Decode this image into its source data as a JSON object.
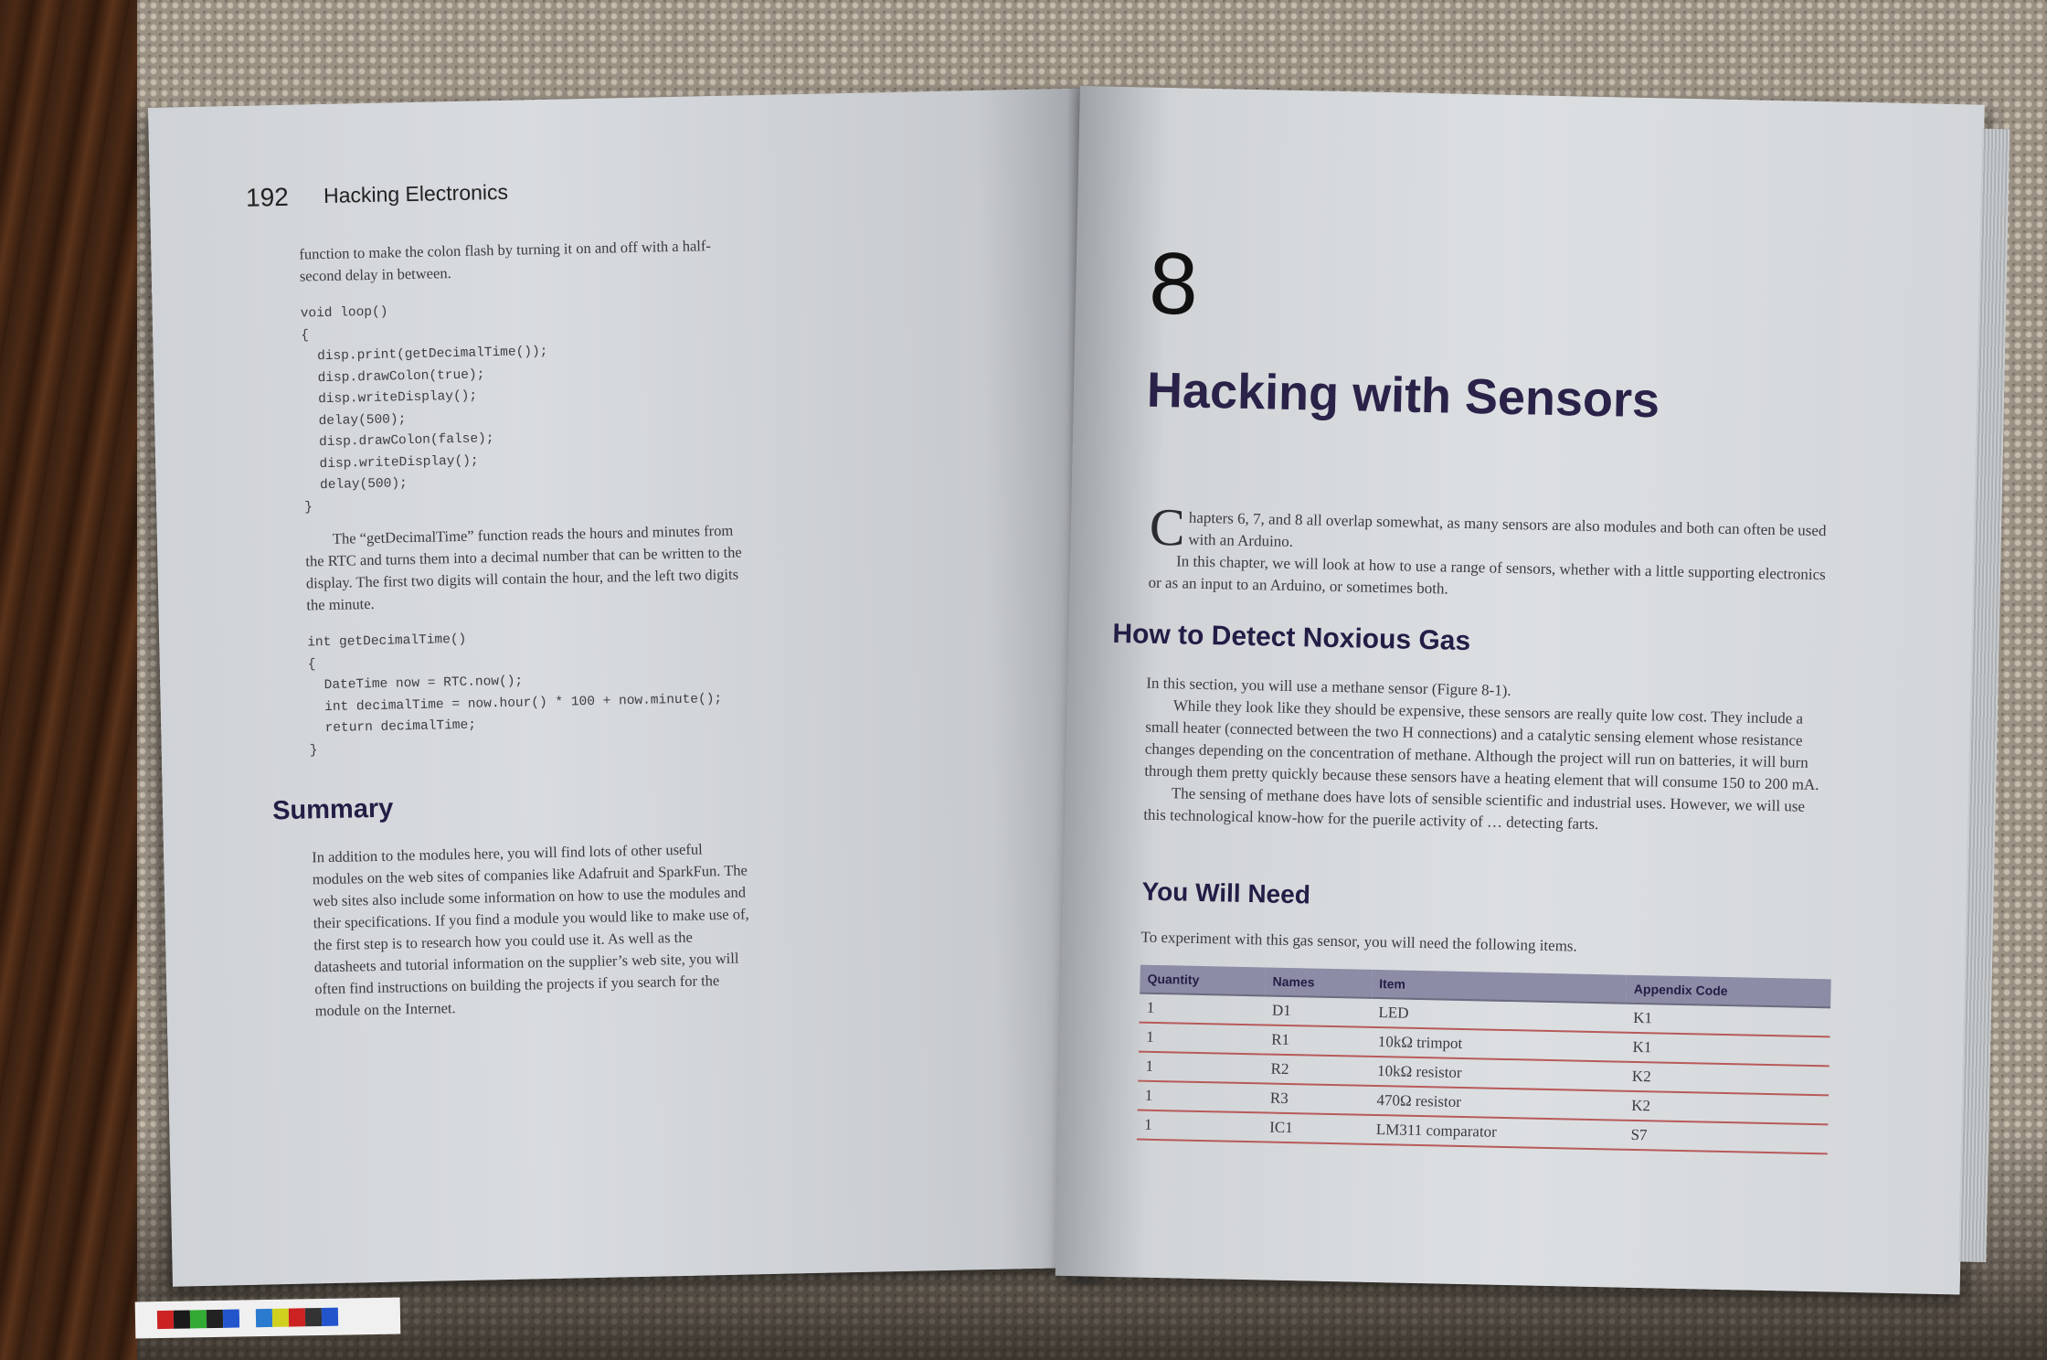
{
  "left_page": {
    "page_number": "192",
    "running_head": "Hacking Electronics",
    "para1": "function to make the colon flash by turning it on and off with a half-second delay in between.",
    "code1": "void loop()\n{\n  disp.print(getDecimalTime());\n  disp.drawColon(true);\n  disp.writeDisplay();\n  delay(500);\n  disp.drawColon(false);\n  disp.writeDisplay();\n  delay(500);\n}",
    "para2": "The “getDecimalTime” function reads the hours and minutes from the RTC and turns them into a decimal number that can be written to the display. The first two digits will contain the hour, and the left two digits the minute.",
    "code2": "int getDecimalTime()\n{\n  DateTime now = RTC.now();\n  int decimalTime = now.hour() * 100 + now.minute();\n  return decimalTime;\n}",
    "summary_heading": "Summary",
    "summary_text": "In addition to the modules here, you will find lots of other useful modules on the web sites of companies like Adafruit and SparkFun. The web sites also include some information on how to use the modules and their specifications. If you find a module you would like to make use of, the first step is to research how you could use it. As well as the datasheets and tutorial information on the supplier’s web site, you will often find instructions on building the projects if you search for the module on the Internet."
  },
  "right_page": {
    "chapter_number": "8",
    "chapter_title": "Hacking with Sensors",
    "intro_dropcap": "C",
    "intro_p1": "hapters 6, 7, and 8 all overlap somewhat, as many sensors are also modules and both can often be used with an Arduino.",
    "intro_p2": "In this chapter, we will look at how to use a range of sensors, whether with a little supporting electronics or as an input to an Arduino, or sometimes both.",
    "section_heading": "How to Detect Noxious Gas",
    "sec_p1": "In this section, you will use a methane sensor (Figure 8-1).",
    "sec_p2": "While they look like they should be expensive, these sensors are really quite low cost. They include a small heater (connected between the two H connections) and a catalytic sensing element whose resistance changes depending on the concentration of methane. Although the project will run on batteries, it will burn through them pretty quickly because these sensors have a heating element that will consume 150 to 200 mA.",
    "sec_p3": "The sensing of methane does have lots of sensible scientific and industrial uses. However, we will use this technological know-how for the puerile activity of … detecting farts.",
    "need_heading": "You Will Need",
    "need_text": "To experiment with this gas sensor, you will need the following items.",
    "table": {
      "headers": [
        "Quantity",
        "Names",
        "Item",
        "Appendix Code"
      ],
      "rows": [
        [
          "1",
          "D1",
          "LED",
          "K1"
        ],
        [
          "1",
          "R1",
          "10kΩ trimpot",
          "K1"
        ],
        [
          "1",
          "R2",
          "10kΩ resistor",
          "K2"
        ],
        [
          "1",
          "R3",
          "470Ω resistor",
          "K2"
        ],
        [
          "1",
          "IC1",
          "LM311 comparator",
          "S7"
        ]
      ]
    }
  },
  "colors": {
    "heading": "#231d46",
    "table_header": "#8c8ca6",
    "table_rule": "#b85a5a"
  }
}
